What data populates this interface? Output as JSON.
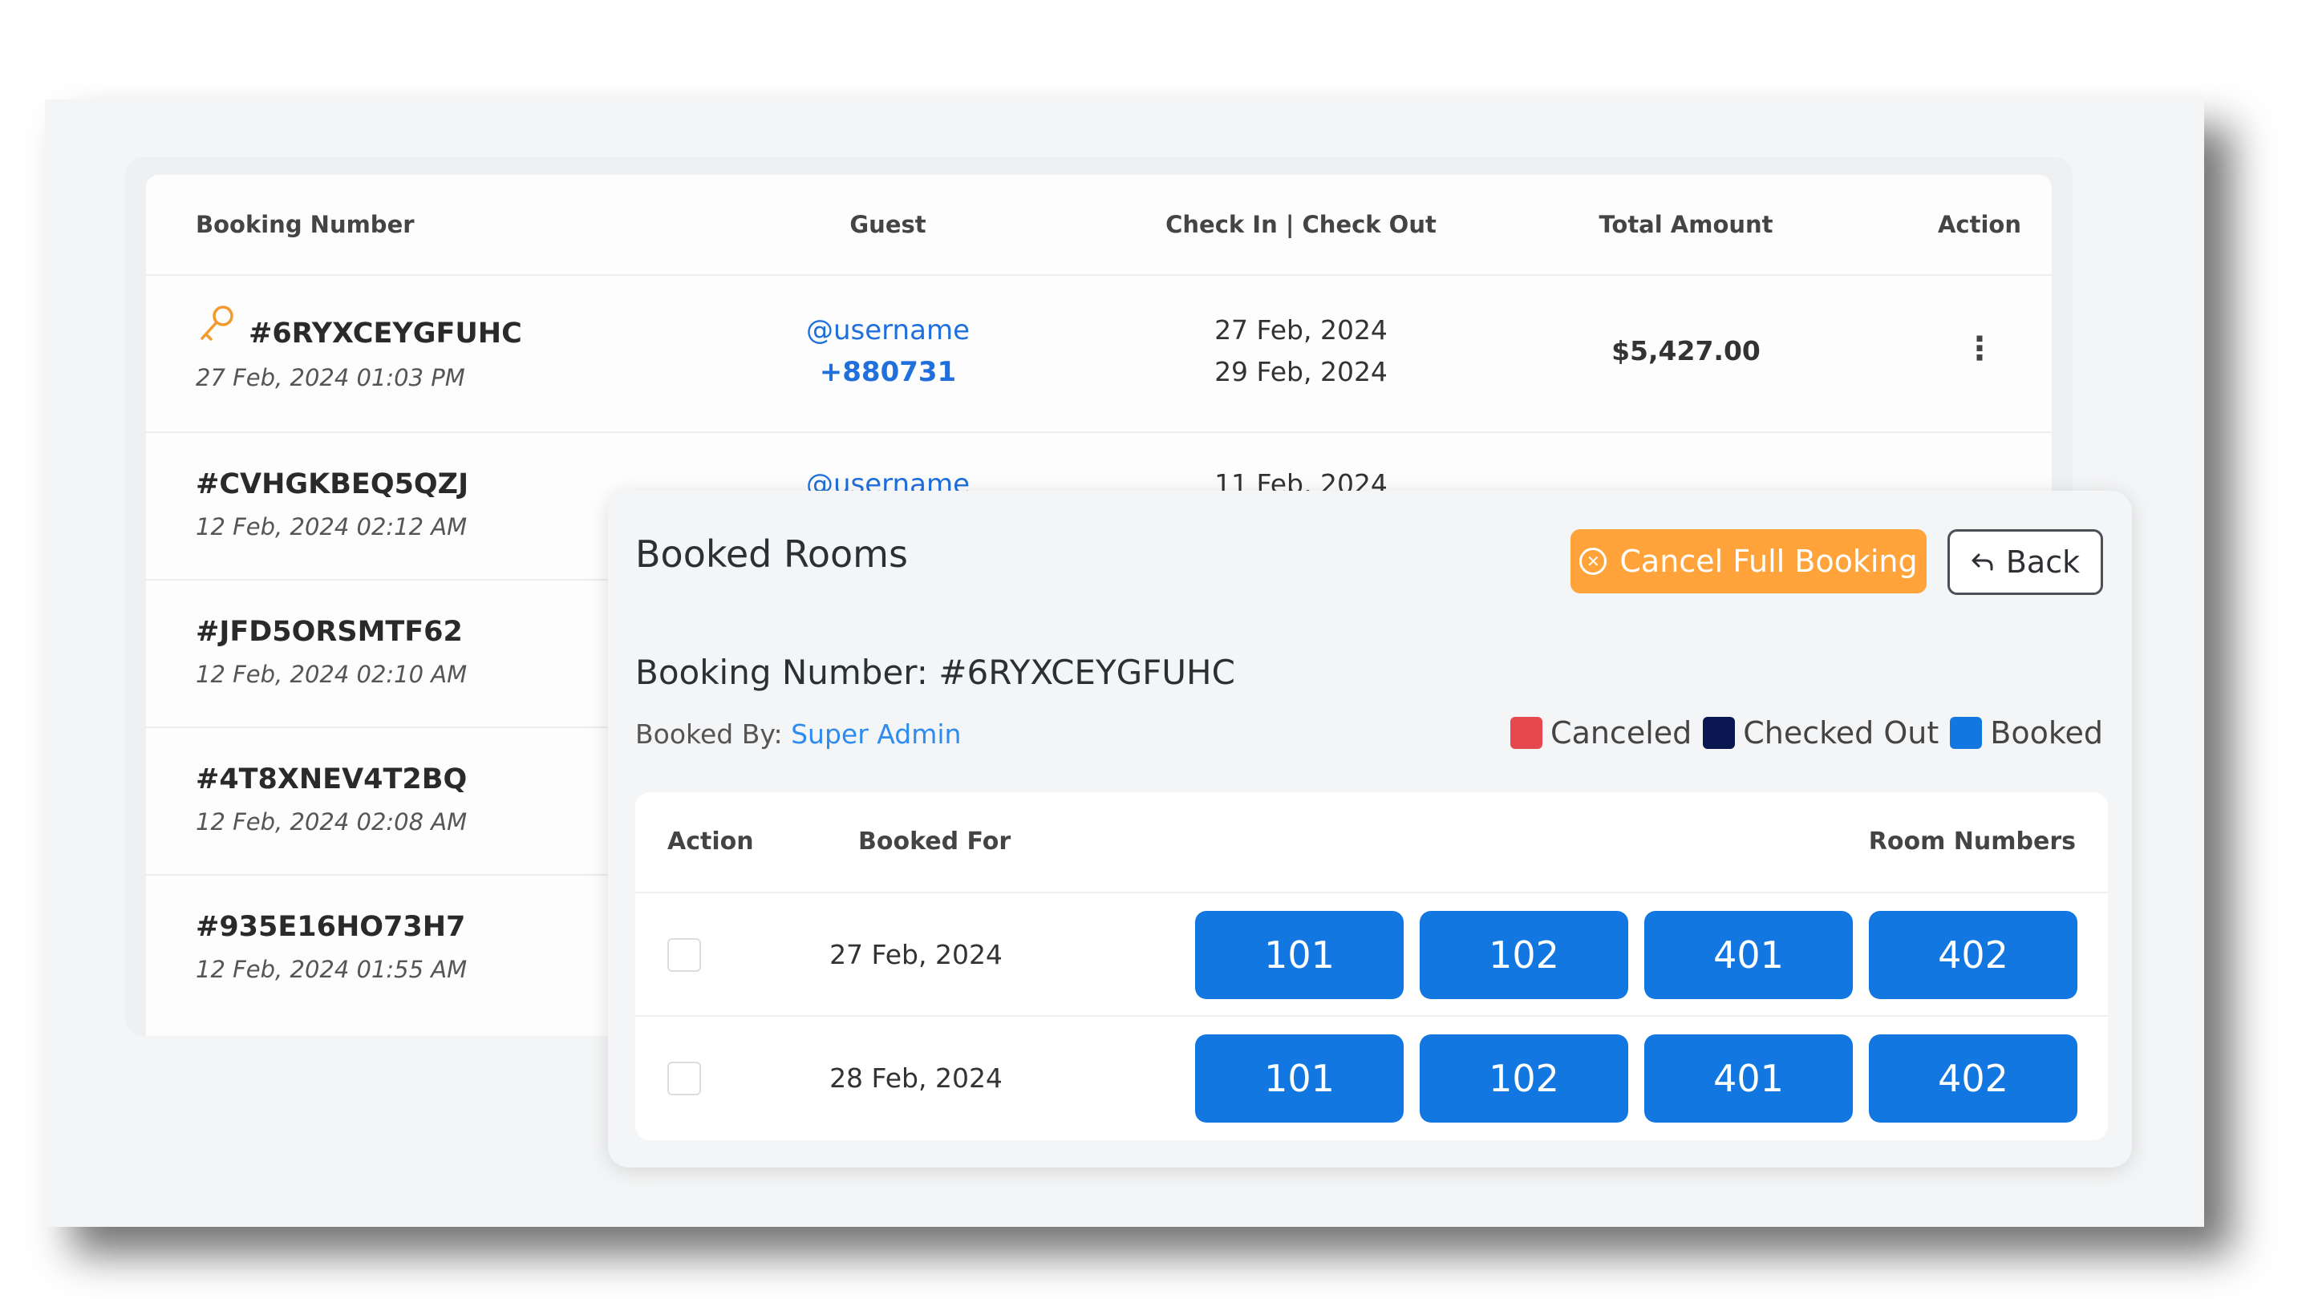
{
  "table": {
    "headers": {
      "booking_number": "Booking Number",
      "guest": "Guest",
      "check_in_out": "Check In | Check Out",
      "total_amount": "Total Amount",
      "action": "Action"
    },
    "rows": [
      {
        "number": "#6RYXCEYGFUHC",
        "date": "27 Feb, 2024 01:03 PM",
        "guest_user": "@username",
        "guest_phone": "+880731",
        "check_in": "27 Feb, 2024",
        "check_out": "29 Feb, 2024",
        "amount": "$5,427.00",
        "action_icon": "kebab-menu-icon"
      },
      {
        "number": "#CVHGKBEQ5QZJ",
        "date": "12 Feb, 2024 02:12 AM",
        "guest_user": "@username",
        "check_in": "11 Feb, 2024"
      },
      {
        "number": "#JFD5ORSMTF62",
        "date": "12 Feb, 2024 02:10 AM"
      },
      {
        "number": "#4T8XNEV4T2BQ",
        "date": "12 Feb, 2024 02:08 AM"
      },
      {
        "number": "#935E16HO73H7",
        "date": "12 Feb, 2024 01:55 AM"
      }
    ]
  },
  "modal": {
    "title": "Booked Rooms",
    "cancel_label": "Cancel Full Booking",
    "back_label": "Back",
    "booking_number_label": "Booking Number: #6RYXCEYGFUHC",
    "booked_by_label": "Booked By:",
    "booked_by_name": "Super Admin",
    "legend": [
      {
        "label": "Canceled",
        "color": "#e5484d"
      },
      {
        "label": "Checked Out",
        "color": "#0b1750"
      },
      {
        "label": "Booked",
        "color": "#1277e1"
      }
    ],
    "table": {
      "headers": {
        "action": "Action",
        "booked_for": "Booked For",
        "room_numbers": "Room Numbers"
      },
      "rows": [
        {
          "date": "27 Feb, 2024",
          "rooms": [
            "101",
            "102",
            "401",
            "402"
          ]
        },
        {
          "date": "28 Feb, 2024",
          "rooms": [
            "101",
            "102",
            "401",
            "402"
          ]
        }
      ]
    }
  },
  "colors": {
    "accent": "#1277e1",
    "warning": "#ffa33a",
    "link": "#1f6fdc"
  }
}
